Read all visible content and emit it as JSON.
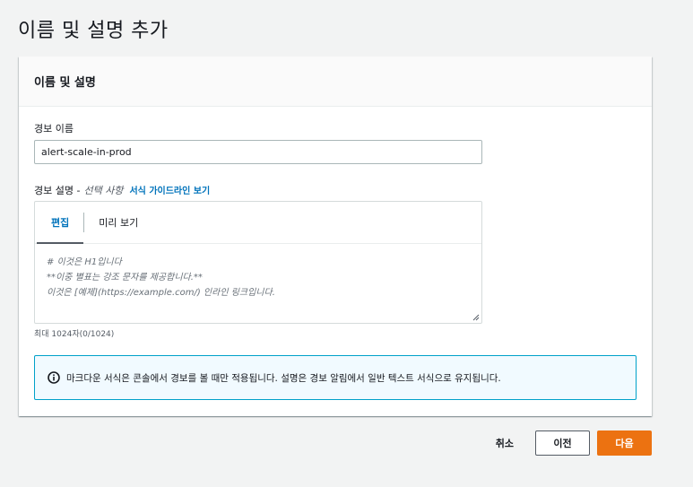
{
  "page": {
    "title": "이름 및 설명 추가"
  },
  "panel": {
    "header_title": "이름 및 설명"
  },
  "alarm_name": {
    "label": "경보 이름",
    "value": "alert-scale-in-prod"
  },
  "alarm_description": {
    "label": "경보 설명 -",
    "optional": "선택 사항",
    "guide_link": "서식 가이드라인 보기",
    "tabs": [
      {
        "label": "편집",
        "active": true
      },
      {
        "label": "미리 보기",
        "active": false
      }
    ],
    "placeholder_lines": [
      "# 이것은 H1입니다",
      "**이중 별표는 강조 문자를 제공합니다.**",
      "이것은 [예제](https://example.com/) 인라인 링크입니다."
    ],
    "char_count": "최대 1024자(0/1024)"
  },
  "info": {
    "icon": "info-icon",
    "text": "마크다운 서식은 콘솔에서 경보를 볼 때만 적용됩니다. 설명은 경보 알림에서 일반 텍스트 서식으로 유지됩니다."
  },
  "footer": {
    "cancel_label": "취소",
    "previous_label": "이전",
    "next_label": "다음"
  },
  "colors": {
    "primary_button": "#ec7211",
    "link": "#0073bb",
    "info_border": "#00a1c9",
    "info_background": "#f1faff"
  }
}
